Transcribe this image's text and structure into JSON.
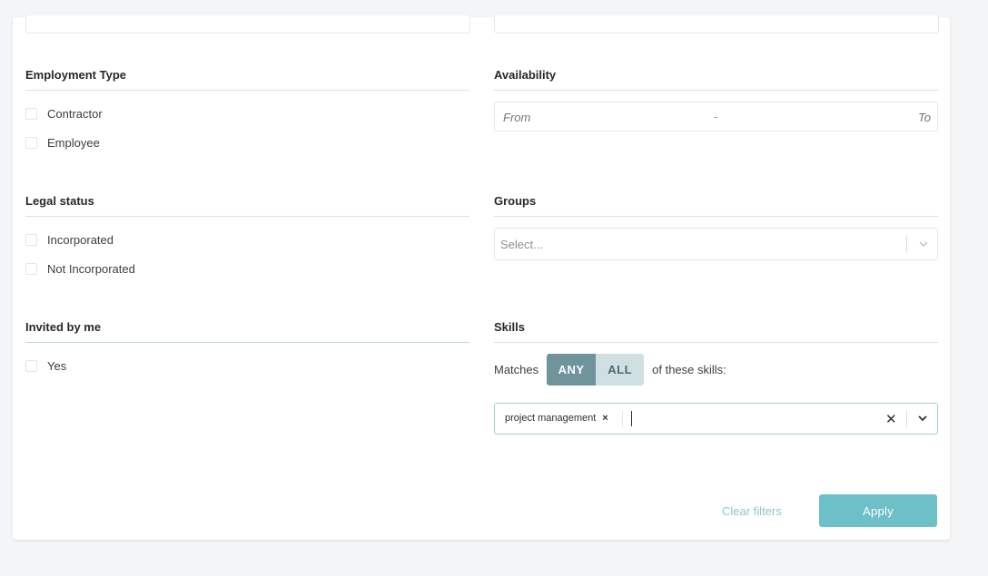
{
  "left": {
    "employment": {
      "title": "Employment Type",
      "options": [
        "Contractor",
        "Employee"
      ]
    },
    "legal": {
      "title": "Legal status",
      "options": [
        "Incorporated",
        "Not Incorporated"
      ]
    },
    "invited": {
      "title": "Invited by me",
      "options": [
        "Yes"
      ]
    }
  },
  "right": {
    "availability": {
      "title": "Availability",
      "from": "From",
      "separator": "-",
      "to": "To"
    },
    "groups": {
      "title": "Groups",
      "placeholder": "Select..."
    },
    "skills": {
      "title": "Skills",
      "matches_prefix": "Matches",
      "any_label": "ANY",
      "all_label": "ALL",
      "matches_suffix": "of these skills:",
      "selected_mode": "ANY",
      "tags": [
        {
          "label": "project management",
          "remove": "×"
        }
      ],
      "clear_glyph": "✕"
    }
  },
  "footer": {
    "clear_label": "Clear filters",
    "apply_label": "Apply"
  },
  "colors": {
    "accent": "#6dbfc8",
    "segment_active": "#6f949b",
    "segment_inactive": "#cfdfe2"
  }
}
